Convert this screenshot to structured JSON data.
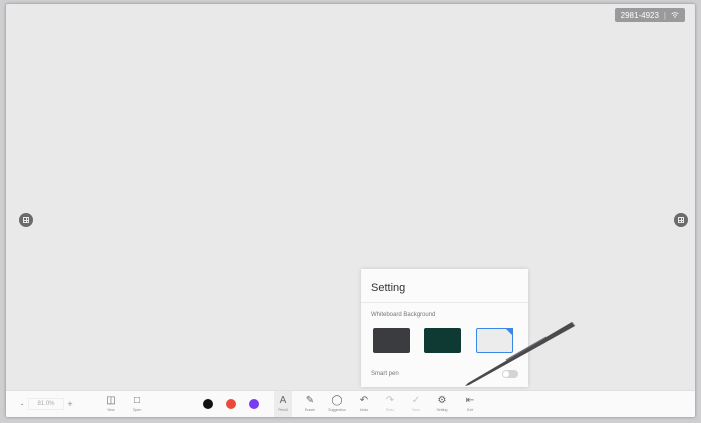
{
  "status": {
    "room_code": "2981-4923",
    "signal_icon": "wifi-icon"
  },
  "side_menus": {
    "left_icon": "grid-icon",
    "right_icon": "grid-icon"
  },
  "settings": {
    "title": "Setting",
    "background_label": "Whiteboard Background",
    "backgrounds": [
      {
        "name": "dark",
        "color": "#3a3c3f",
        "selected": false
      },
      {
        "name": "green",
        "color": "#0f3a33",
        "selected": false
      },
      {
        "name": "light",
        "color": "#ececec",
        "selected": true
      }
    ],
    "smart_pen_label": "Smart pen",
    "smart_pen_on": false
  },
  "toolbar": {
    "zoom": {
      "minus": "-",
      "value": "81.0%",
      "plus": "+"
    },
    "new_label": "New",
    "open_label": "Open",
    "colors": [
      "#111111",
      "#e84b3c",
      "#7a3cf0"
    ],
    "pencil_label": "Pencil",
    "eraser_label": "Eraser",
    "suggestion_label": "Suggestion",
    "undo_label": "Undo",
    "redo_label": "Redo",
    "save_label": "Save",
    "setting_label": "Setting",
    "exit_label": "Exit"
  }
}
